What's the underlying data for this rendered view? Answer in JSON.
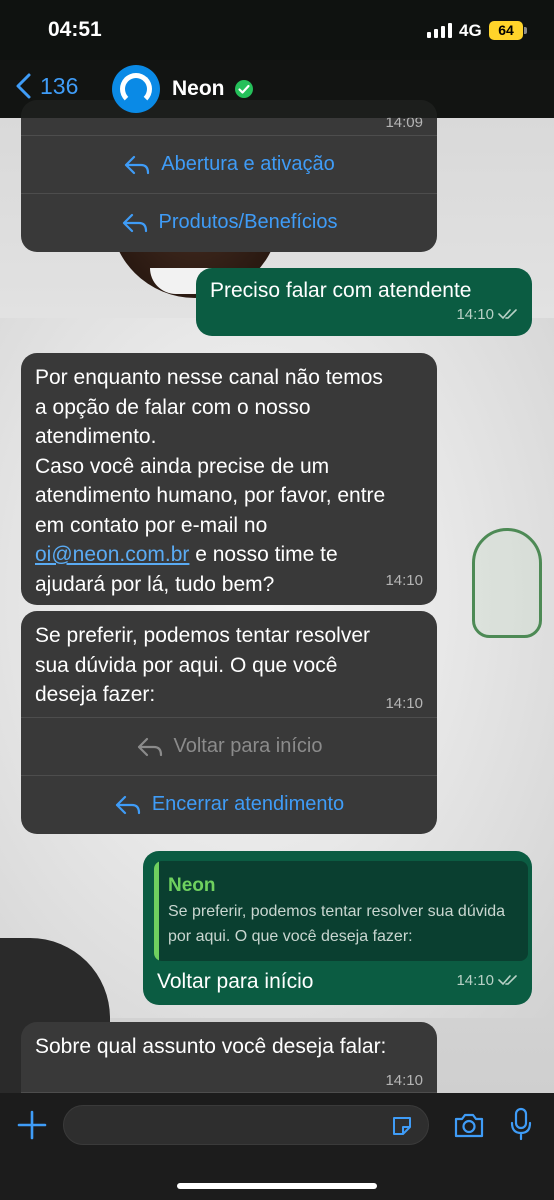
{
  "status_bar": {
    "time": "04:51",
    "network": "4G",
    "battery": "64"
  },
  "nav": {
    "back_count": "136",
    "contact_name": "Neon",
    "verified": true
  },
  "partial_bubble": {
    "time": "14:09",
    "buttons": [
      "Abertura e ativação",
      "Produtos/Benefícios"
    ]
  },
  "messages": {
    "out1": {
      "text": "Preciso falar com atendente",
      "time": "14:10"
    },
    "in1": {
      "text_before": "Por enquanto nesse canal não temos\na opção de falar com o nosso\natendimento.\nCaso você ainda precise de um\natendimento humano, por favor, entre\nem contato por e-mail no\n",
      "link": "oi@neon.com.br",
      "text_after": " e nosso time te\najudará por lá, tudo bem?",
      "time": "14:10"
    },
    "in2": {
      "text": "Se preferir, podemos tentar resolver\nsua dúvida por aqui. O que você\ndeseja fazer:",
      "time": "14:10",
      "buttons": [
        "Voltar para início",
        "Encerrar atendimento"
      ]
    },
    "out2": {
      "quote_name": "Neon",
      "quote_text": "Se preferir, podemos tentar resolver sua dúvida por aqui. O que você deseja fazer:",
      "text": "Voltar para início",
      "time": "14:10"
    },
    "in3": {
      "text": "Sobre qual assunto você deseja falar:",
      "time": "14:10"
    }
  },
  "colors": {
    "accent": "#3f9cf7",
    "outgoing_bubble": "#0b5c42",
    "incoming_bubble": "#393939",
    "quote_accent": "#6fd15f"
  },
  "icons": [
    "back-chevron-icon",
    "verified-badge-icon",
    "reply-arrow-icon",
    "plus-icon",
    "sticker-icon",
    "camera-icon",
    "microphone-icon"
  ]
}
